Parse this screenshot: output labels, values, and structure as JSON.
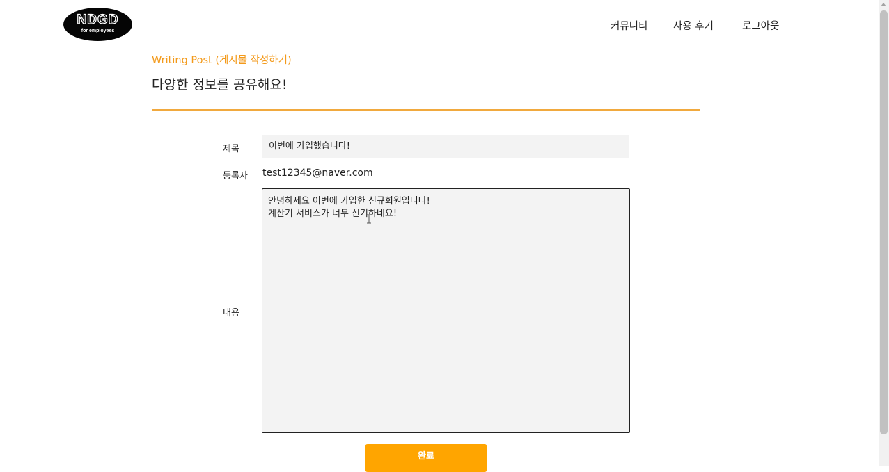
{
  "header": {
    "logo": {
      "main": "NDGD",
      "sub": "for employees"
    },
    "nav": [
      {
        "label": "커뮤니티"
      },
      {
        "label": "사용 후기"
      },
      {
        "label": "로그아웃"
      }
    ]
  },
  "section": {
    "subtitle": "Writing Post (게시물 작성하기)",
    "title": "다양한 정보를 공유해요!"
  },
  "form": {
    "title_label": "제목",
    "title_value": "이번에 가입했습니다!",
    "author_label": "등록자",
    "author_value": "test12345@naver.com",
    "content_label": "내용",
    "content_value": "안녕하세요 이번에 가입한 신규회원입니다!\n계산기 서비스가 너무 신기하네요!",
    "submit_label": "완료"
  },
  "colors": {
    "accent": "#f39a1b",
    "button": "#ffa500",
    "input_bg": "#f3f3f3"
  }
}
